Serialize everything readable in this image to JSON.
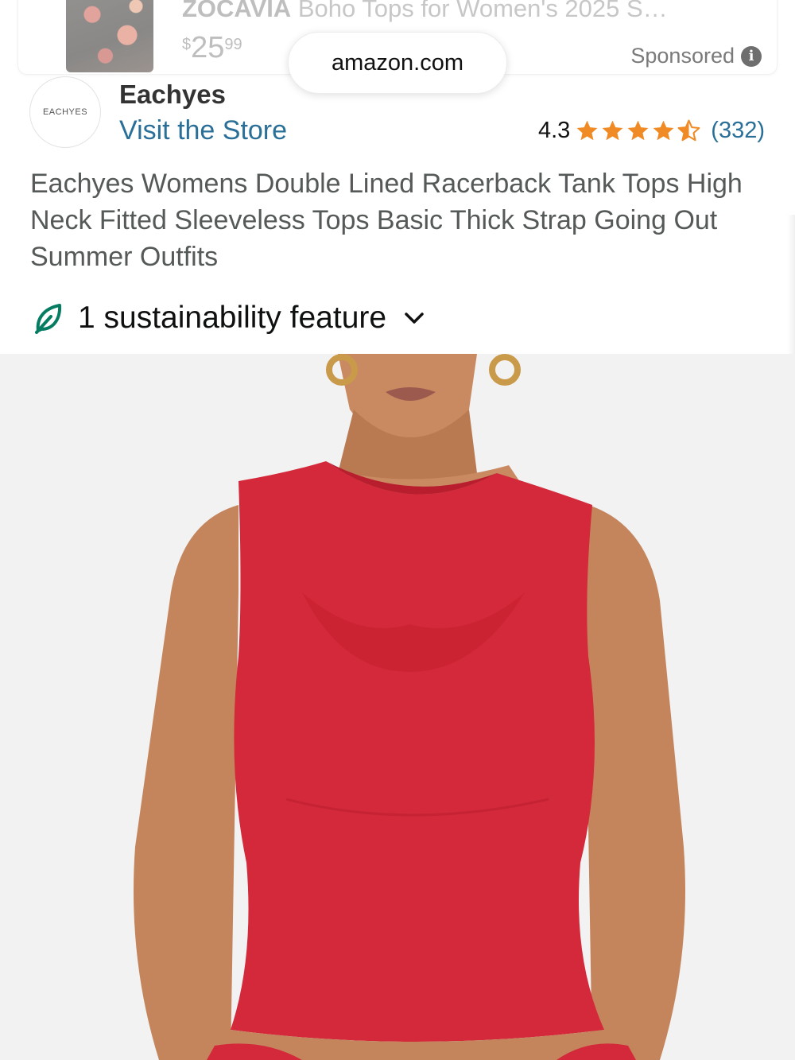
{
  "ad": {
    "brand": "ZOCAVIA",
    "title_rest": " Boho Tops for Women's 2025 S…",
    "price_currency": "$",
    "price_whole": "25",
    "price_fraction": "99",
    "sponsored_label": "Sponsored",
    "info_glyph": "i"
  },
  "url_bar": {
    "domain": "amazon.com"
  },
  "brand": {
    "logo_text": "EACHYES",
    "name": "Eachyes",
    "store_link": "Visit the Store"
  },
  "rating": {
    "value": "4.3",
    "stars": 4.3,
    "count": "(332)",
    "star_color": "#f08a24"
  },
  "product": {
    "title": "Eachyes Womens Double Lined Racerback Tank Tops High Neck Fitted Sleeveless Tops Basic Thick Strap Going Out Summer Outfits"
  },
  "sustainability": {
    "label": "1 sustainability feature",
    "icon": "leaf-icon",
    "icon_color": "#067d62"
  },
  "colors": {
    "link": "#2a6f97",
    "tank": "#d3293a",
    "skin": "#c9875e"
  }
}
